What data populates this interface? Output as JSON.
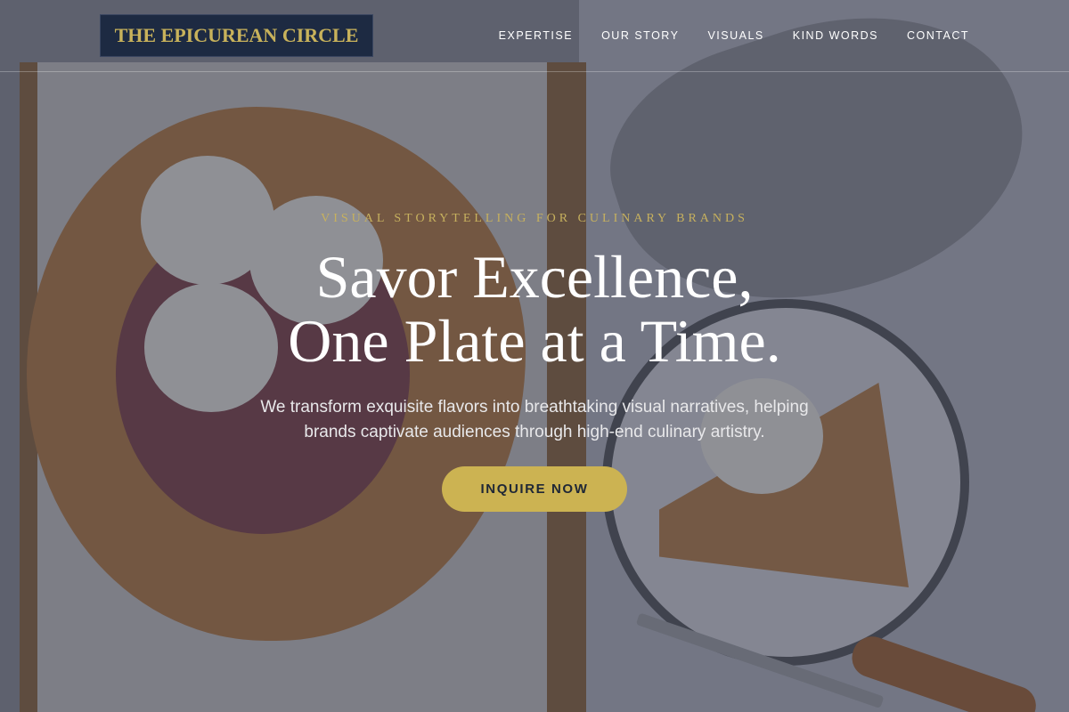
{
  "site": {
    "logo_text": "THE EPICUREAN CIRCLE"
  },
  "nav": {
    "items": [
      {
        "label": "EXPERTISE"
      },
      {
        "label": "OUR STORY"
      },
      {
        "label": "VISUALS"
      },
      {
        "label": "KIND WORDS"
      },
      {
        "label": "CONTACT"
      }
    ]
  },
  "hero": {
    "eyebrow": "VISUAL STORYTELLING FOR CULINARY BRANDS",
    "title_line1": "Savor Excellence,",
    "title_line2": "One Plate at a Time.",
    "subtitle_line1": "We transform exquisite flavors into breathtaking visual narratives, helping",
    "subtitle_line2": "brands captivate audiences through high-end culinary artistry.",
    "cta_label": "INQUIRE NOW",
    "background_image": "galette-with-ice-cream-photo"
  },
  "colors": {
    "accent_gold": "#ccb352",
    "logo_bg": "#1d2a42",
    "overlay": "#323646"
  }
}
